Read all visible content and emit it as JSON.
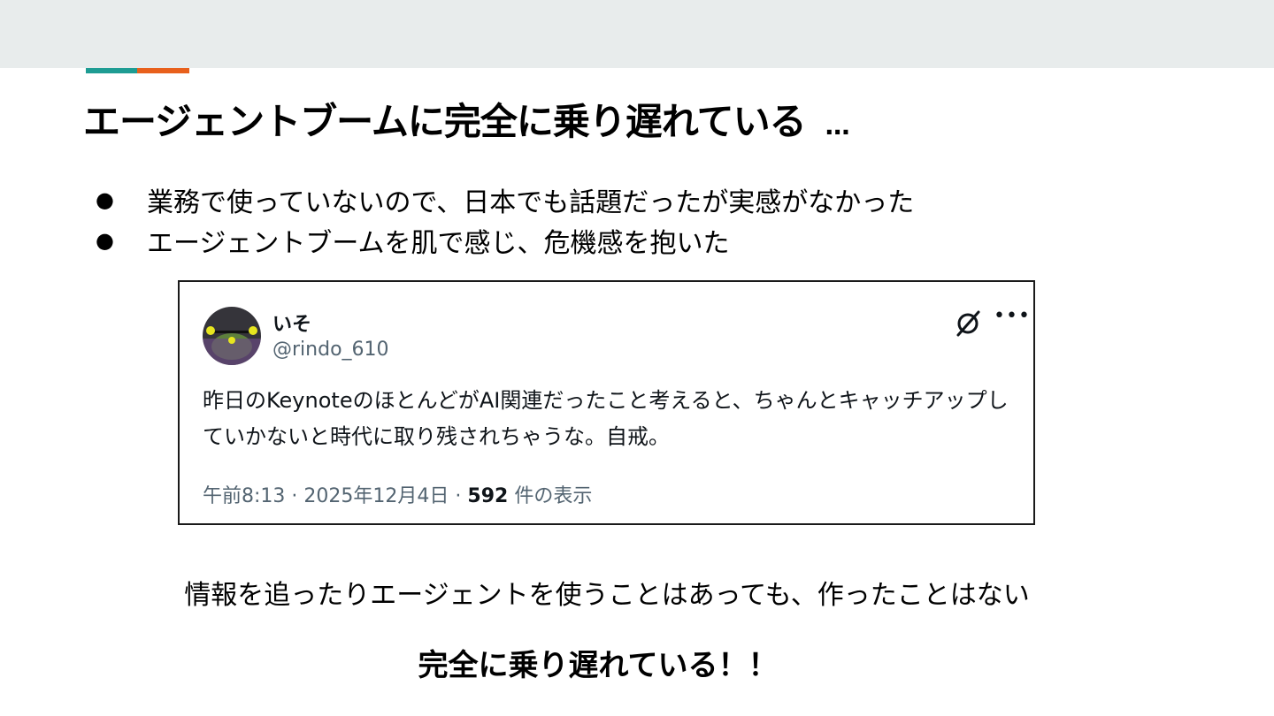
{
  "colors": {
    "accent_teal": "#1e9c93",
    "accent_orange": "#e8601c",
    "header_bg": "#e8ecec"
  },
  "slide": {
    "title": "エージェントブームに完全に乗り遅れている",
    "title_suffix": "…",
    "bullets": [
      "業務で使っていないので、日本でも話題だったが実感がなかった",
      "エージェントブームを肌で感じ、危機感を抱いた"
    ],
    "caption": "情報を追ったりエージェントを使うことはあっても、作ったことはない",
    "conclusion": "完全に乗り遅れている！！"
  },
  "tweet": {
    "display_name": "いそ",
    "handle": "@rindo_610",
    "icons": [
      "translate-off-icon",
      "more-icon"
    ],
    "text": "昨日のKeynoteのほとんどがAI関連だったこと考えると、ちゃんとキャッチアップしていかないと時代に取り残されちゃうな。自戒。",
    "time": "午前8:13",
    "date": "2025年12月4日",
    "separator": "·",
    "view_count": "592",
    "view_label": "件の表示"
  }
}
